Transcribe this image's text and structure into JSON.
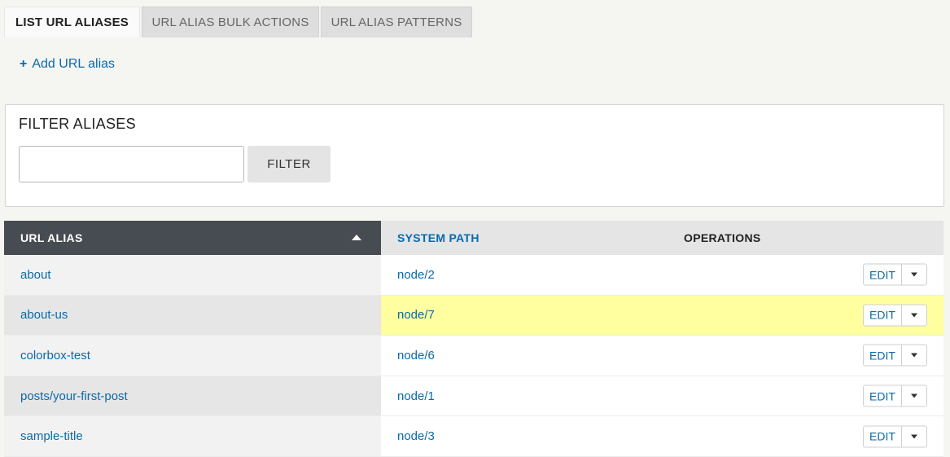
{
  "tabs": [
    {
      "label": "LIST URL ALIASES",
      "active": true
    },
    {
      "label": "URL ALIAS BULK ACTIONS",
      "active": false
    },
    {
      "label": "URL ALIAS PATTERNS",
      "active": false
    }
  ],
  "actions": {
    "add_icon": "+",
    "add_label": "Add URL alias"
  },
  "filter": {
    "title": "FILTER ALIASES",
    "input_value": "",
    "button_label": "FILTER"
  },
  "table": {
    "headers": {
      "alias": "URL ALIAS",
      "path": "SYSTEM PATH",
      "operations": "OPERATIONS"
    },
    "sort_icon": "sort-ascending-icon",
    "rows": [
      {
        "alias": "about",
        "path": "node/2",
        "edit": "EDIT"
      },
      {
        "alias": "about-us",
        "path": "node/7",
        "edit": "EDIT"
      },
      {
        "alias": "colorbox-test",
        "path": "node/6",
        "edit": "EDIT"
      },
      {
        "alias": "posts/your-first-post",
        "path": "node/1",
        "edit": "EDIT"
      },
      {
        "alias": "sample-title",
        "path": "node/3",
        "edit": "EDIT"
      }
    ]
  },
  "colors": {
    "link": "#0a6aab",
    "header_dark": "#474c52",
    "highlight": "#ffff9f"
  }
}
